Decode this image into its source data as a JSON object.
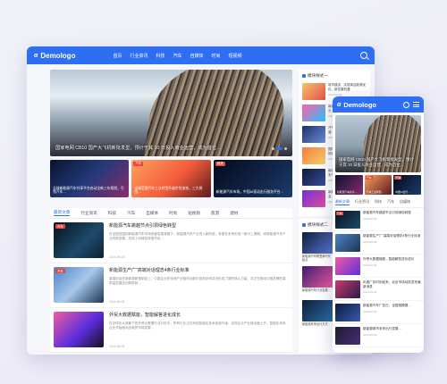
{
  "site": {
    "logo_mark": "α",
    "logo_text": "Demologo"
  },
  "nav": {
    "items": [
      "首页",
      "行业资讯",
      "科技",
      "汽车",
      "自媒体",
      "时尚",
      "短视频"
    ]
  },
  "hero": {
    "caption": "国家电网 CB10 国产大飞机新批发型，预计于其 10 日投入商业运营，成为首位…"
  },
  "thumbs": [
    {
      "tag": "",
      "title": "全球新能源汽车共享平台启动全新三年规划，引领汽车…"
    },
    {
      "tag": "汽车",
      "title": "全球范围汽车工业转型升级步伐加快，三大挑战…"
    },
    {
      "tag": "视频",
      "title": "新能源汽车市场，中国AI驱动出行服务平台…"
    }
  ],
  "tabs": [
    "最新文章",
    "行业资讯",
    "科技",
    "汽车",
    "自媒体",
    "时尚",
    "短视频",
    "旅游",
    "建材"
  ],
  "articles": [
    {
      "tag": "汽车",
      "title": "新能源汽车跳越节点引领绿色转型",
      "summary": "在全国范围的新能源汽车市场快速发展背景下，新能源汽车产业进入新阶段，有望在未来形成一新兴上周期，而新能源汽车产业的新发展，总体上对绿色转型作出…",
      "date": "2024-06-06"
    },
    {
      "tag": "汽车",
      "title": "新能源生产广\"高端对话理念4条行业标准",
      "summary": "高端对话在新能源新规制定上，中国企业在电池产业链的创新引领和全球共识形成了新的核心力量，并正在推动中国品牌的高质量发展迈向新阶段…",
      "date": "2024-06-06"
    },
    {
      "tag": "",
      "title": "外贸大数据赋能，智能解答进化成长",
      "summary": "在全球化大背景下的外贸大数据行业分析中，所有行业正在利用智能化技术加速升级，实现企业产业链全面上升，智能化未来企业开始面向全新的市场发展…",
      "date": "2024-06-06"
    }
  ],
  "sidebar1": {
    "title": "模块样式一",
    "items": [
      {
        "title": "城市建设，实现清洁能源优化，新发展机遇",
        "date": "2024-06-06"
      },
      {
        "title": "新能源城市风险平台迎来增长",
        "date": "2024-06-06"
      },
      {
        "title": "汽车行业转型出行加速运营…",
        "date": "2024-06-06"
      },
      {
        "title": "国际建筑文化，城市中心新规划发展",
        "date": "2024-06-06"
      },
      {
        "title": "新能源汽车，新闻解读当下未来…",
        "date": "2024-06-06"
      },
      {
        "title": "新能源汽车创新新品牌发布会…",
        "date": "2024-06-06"
      }
    ]
  },
  "sidebar2": {
    "title": "模块样式二",
    "items": [
      "新能源汽车联盟新时代起点",
      "自动驾驶迎来新业务",
      "新能源汽车行业发展…",
      "智慧城市中心建设",
      "新能源未来出行方式",
      "品牌升级首批交付"
    ]
  },
  "phone": {
    "hero_caption": "国家电网 CB10 国产大飞机新批发型，预计于其 10 日投入商业运营，成为首位…",
    "thumbs": [
      {
        "tag": "",
        "title": "新能源汽车共享…"
      },
      {
        "tag": "汽车",
        "title": "汽车工业转型…"
      },
      {
        "tag": "汽车",
        "title": "中国AI出行…"
      }
    ],
    "tabs": [
      "最新文章",
      "行业资讯",
      "科技",
      "汽车",
      "自媒体"
    ],
    "items": [
      {
        "tag": "汽车",
        "title": "新能源汽车跳越节点引领绿色转型",
        "date": "2024-06-06"
      },
      {
        "tag": "",
        "title": "新能源生产广\"高端对话理念4条行业标准",
        "date": "2024-06-06"
      },
      {
        "tag": "",
        "title": "外贸大数据赋能，智能解答进化成长",
        "date": "2024-06-06"
      },
      {
        "tag": "",
        "title": "年度广告时刻迎来，北京市场动态发布最新消息",
        "date": "2024-06-06"
      },
      {
        "tag": "",
        "title": "新能源汽车广告日，全国规模展…",
        "date": "2024-06-06"
      },
      {
        "tag": "",
        "title": "新能源城市未来出行发展…",
        "date": "2024-06-06"
      }
    ]
  }
}
